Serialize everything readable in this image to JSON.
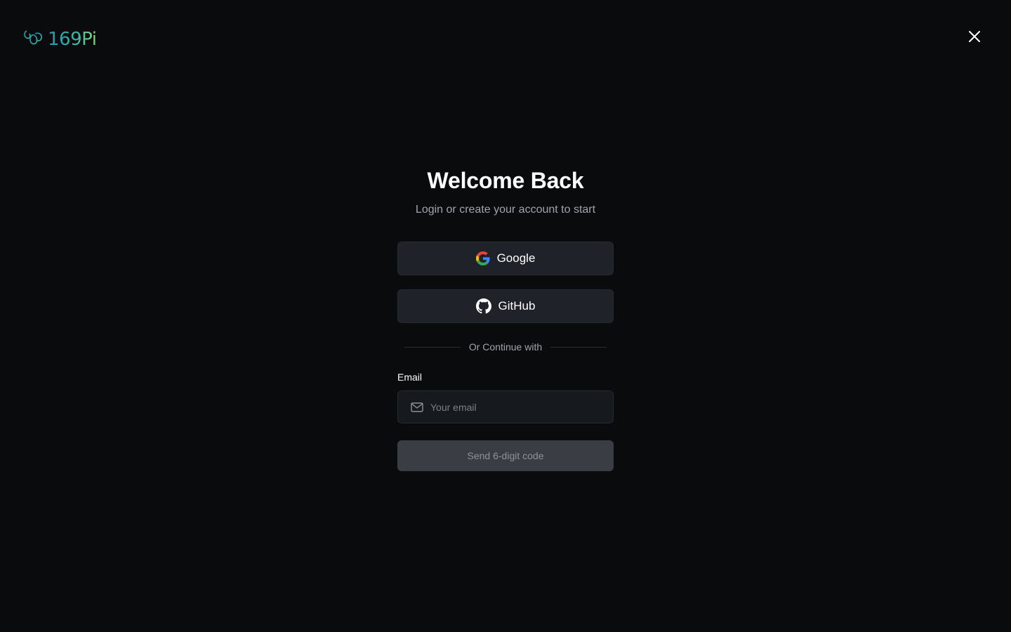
{
  "brand": {
    "logo_text": "169Pi",
    "logo_colors": [
      "#1b9ab3",
      "#3fb5a7",
      "#8fcf7a"
    ]
  },
  "header": {
    "close_icon": "close-icon"
  },
  "auth": {
    "title": "Welcome Back",
    "subtitle": "Login or create your account to start",
    "google_label": "Google",
    "github_label": "GitHub",
    "divider_text": "Or Continue with",
    "email_label": "Email",
    "email_placeholder": "Your email",
    "email_value": "",
    "send_label": "Send 6-digit code"
  },
  "icons": {
    "google": "google-icon",
    "github": "github-icon",
    "mail": "mail-icon"
  },
  "colors": {
    "background": "#0a0b0d",
    "button_bg": "#1f2329",
    "input_bg": "#16191d",
    "disabled_button_bg": "#3a3d43",
    "muted_text": "#a1a4ab"
  }
}
